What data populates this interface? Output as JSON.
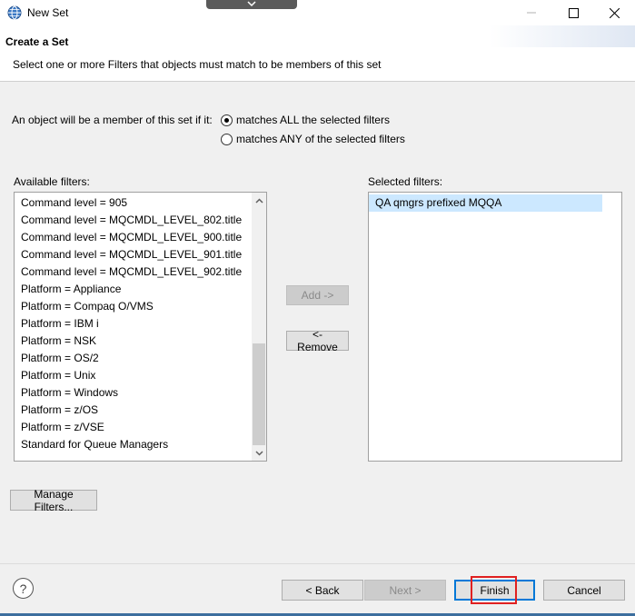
{
  "window": {
    "title": "New Set",
    "icon": "globe-icon",
    "controls": [
      "minimize-icon",
      "maximize-icon",
      "close-icon"
    ]
  },
  "banner": {
    "heading": "Create a Set",
    "description": "Select one or more Filters that objects must match to be members of this set"
  },
  "membership": {
    "label": "An object will be a member of this set if it:",
    "options": [
      {
        "label": "matches ALL the selected filters",
        "checked": true
      },
      {
        "label": "matches ANY of the selected filters",
        "checked": false
      }
    ]
  },
  "available": {
    "label": "Available filters:",
    "items": [
      "Command level = 905",
      "Command level = MQCMDL_LEVEL_802.title",
      "Command level = MQCMDL_LEVEL_900.title",
      "Command level = MQCMDL_LEVEL_901.title",
      "Command level = MQCMDL_LEVEL_902.title",
      "Platform = Appliance",
      "Platform = Compaq O/VMS",
      "Platform = IBM i",
      "Platform = NSK",
      "Platform = OS/2",
      "Platform = Unix",
      "Platform = Windows",
      "Platform = z/OS",
      "Platform = z/VSE",
      "Standard for Queue Managers"
    ]
  },
  "selected": {
    "label": "Selected filters:",
    "items": [
      "QA qmgrs prefixed MQQA"
    ]
  },
  "buttons": {
    "add": "Add ->",
    "remove": "<- Remove",
    "manage": "Manage Filters...",
    "back": "< Back",
    "next": "Next >",
    "finish": "Finish",
    "cancel": "Cancel"
  },
  "colors": {
    "accent": "#0078d7",
    "highlight": "#e02020",
    "selection": "#cce8ff"
  }
}
